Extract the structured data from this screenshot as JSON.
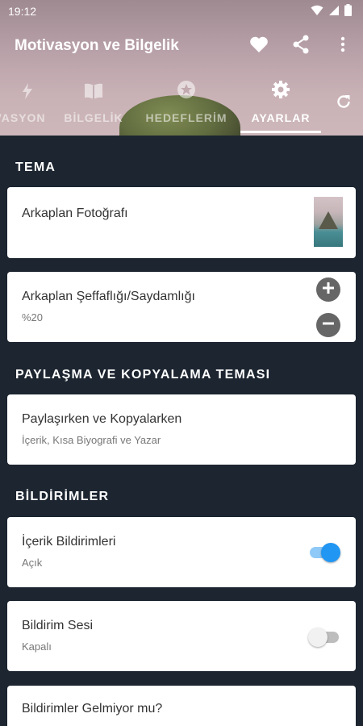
{
  "status": {
    "time": "19:12"
  },
  "appbar": {
    "title": "Motivasyon ve Bilgelik"
  },
  "tabs": [
    {
      "label": "MOTİVASYON",
      "icon": "lightning-icon"
    },
    {
      "label": "BİLGELİK",
      "icon": "book-icon"
    },
    {
      "label": "HEDEFLERİM",
      "icon": "star-circle-icon"
    },
    {
      "label": "AYARLAR",
      "icon": "gear-icon"
    }
  ],
  "sections": {
    "tema": "TEMA",
    "paylasma": "PAYLAŞMA VE KOPYALAMA TEMASI",
    "bildirimler": "BİLDİRİMLER"
  },
  "settings": {
    "background_photo": {
      "title": "Arkaplan Fotoğrafı"
    },
    "transparency": {
      "title": "Arkaplan Şeffaflığı/Saydamlığı",
      "value": "%20"
    },
    "share_copy": {
      "title": "Paylaşırken ve Kopyalarken",
      "subtitle": "İçerik, Kısa Biyografi ve Yazar"
    },
    "content_notifications": {
      "title": "İçerik Bildirimleri",
      "state": "Açık",
      "on": true
    },
    "notification_sound": {
      "title": "Bildirim Sesi",
      "state": "Kapalı",
      "on": false
    },
    "not_receiving": {
      "title": "Bildirimler Gelmiyor mu?"
    }
  },
  "colors": {
    "accent": "#2196F3",
    "background": "#1c2530",
    "card": "#ffffff"
  }
}
